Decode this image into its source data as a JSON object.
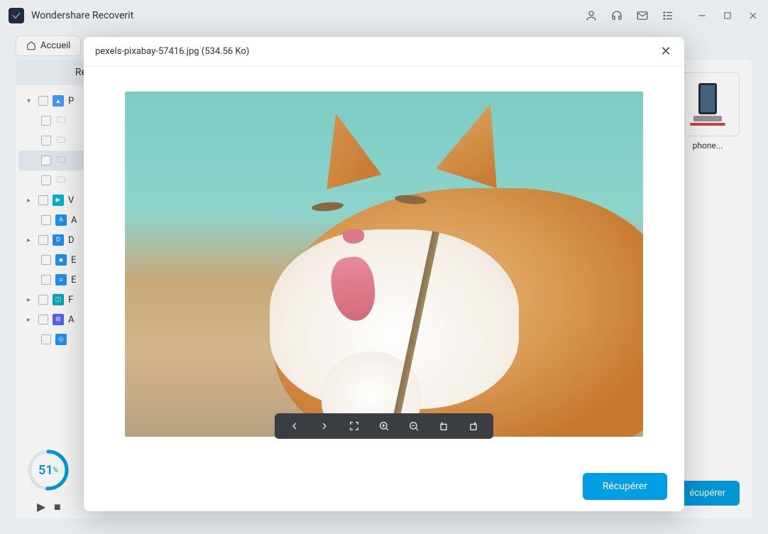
{
  "app": {
    "title": "Wondershare Recoverit"
  },
  "breadcrumb": {
    "home": "Accueil"
  },
  "sidebar": {
    "header": "Répertoi",
    "items": [
      {
        "label": "P",
        "iconClass": "image"
      },
      {
        "label": "V",
        "iconClass": "video"
      },
      {
        "label": "A",
        "iconClass": "audio"
      },
      {
        "label": "D",
        "iconClass": "doc"
      },
      {
        "label": "E",
        "iconClass": "doc"
      },
      {
        "label": "E",
        "iconClass": "doc"
      },
      {
        "label": "F",
        "iconClass": "zip"
      },
      {
        "label": "A",
        "iconClass": "app"
      }
    ]
  },
  "progress": {
    "percent": 51,
    "unit": "%"
  },
  "content": {
    "thumb_label": "phone...",
    "recover_bg": "écupérer"
  },
  "modal": {
    "title": "pexels-pixabay-57416.jpg (534.56 Ko)",
    "recover": "Récupérer"
  }
}
